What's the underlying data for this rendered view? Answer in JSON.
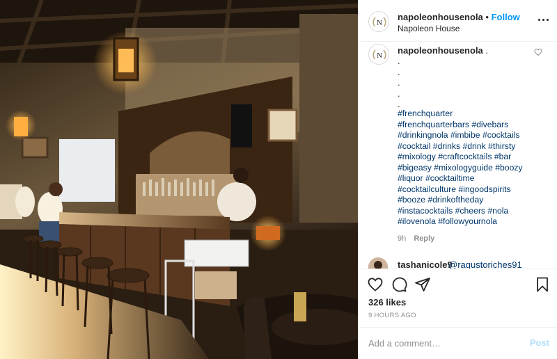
{
  "post_header": {
    "username": "napoleonhousenola",
    "separator": "•",
    "follow_label": "Follow",
    "location": "Napoleon House",
    "avatar_icon": "napoleon-house-crest-icon",
    "more_icon": "more-options-icon"
  },
  "caption": {
    "username": "napoleonhousenola",
    "first_dot": ".",
    "dot_lines": [
      ".",
      ".",
      ".",
      ".",
      "."
    ],
    "hashtag_lines": [
      "#frenchquarter",
      "#frenchquarterbars #divebars",
      "#drinkingnola #imbibe #cocktails",
      "#cocktail #drinks #drink #thirsty",
      "#mixology #craftcocktails #bar",
      "#bigeasy #mixologyguide #boozy",
      "#liquor #cocktailtime",
      "#cocktailculture #ingoodspirits",
      "#booze #drinkoftheday",
      "#instacocktails #cheers #nola",
      "#ilovenola #followyournola"
    ],
    "time": "9h",
    "reply_label": "Reply",
    "like_icon": "heart-outline-icon"
  },
  "reply_comment": {
    "username": "tashanicole9",
    "text": "@ragustoriches91"
  },
  "actions": {
    "like_icon": "heart-icon",
    "comment_icon": "comment-icon",
    "share_icon": "paper-plane-icon",
    "save_icon": "bookmark-icon"
  },
  "likes_text": "326 likes",
  "time_ago": "9 HOURS AGO",
  "add_comment": {
    "placeholder": "Add a comment…",
    "post_label": "Post"
  },
  "colors": {
    "link_blue": "#0095f6",
    "hashtag": "#00376b",
    "muted": "#8e8e8e",
    "post_disabled": "#b2dffc"
  }
}
